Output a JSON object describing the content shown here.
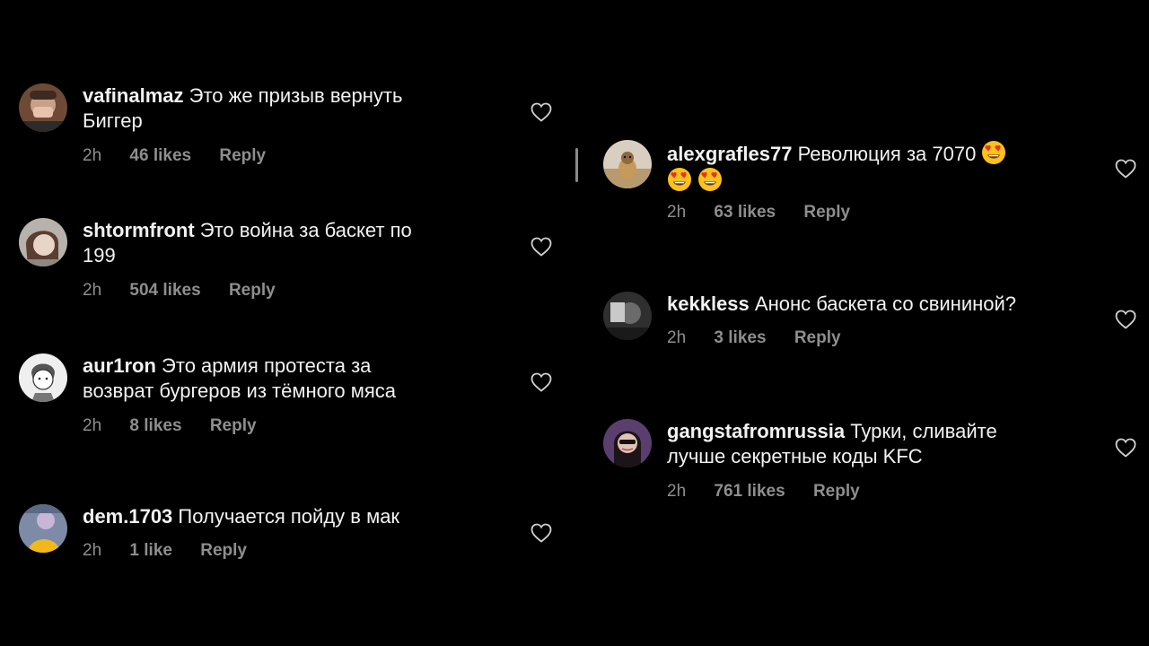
{
  "comments": [
    {
      "username": "vafinalmaz",
      "text": "Это же призыв вернуть",
      "text2": "Биггер",
      "time": "2h",
      "likes": "46 likes",
      "reply": "Reply"
    },
    {
      "username": "shtormfront",
      "text": "Это война за баскет по",
      "text2": "199",
      "time": "2h",
      "likes": "504 likes",
      "reply": "Reply"
    },
    {
      "username": "aur1ron",
      "text": "Это армия протеста за",
      "text2": "возврат бургеров из тёмного мяса",
      "time": "2h",
      "likes": "8 likes",
      "reply": "Reply"
    },
    {
      "username": "dem.1703",
      "text": "Получается пойду в мак",
      "time": "2h",
      "likes": "1 like",
      "reply": "Reply"
    },
    {
      "username": "alexgrafles77",
      "text": "Революция за 7070",
      "time": "2h",
      "likes": "63 likes",
      "reply": "Reply"
    },
    {
      "username": "kekkless",
      "text": "Анонс баскета со свининой?",
      "time": "2h",
      "likes": "3 likes",
      "reply": "Reply"
    },
    {
      "username": "gangstafromrussia",
      "text": "Турки, сливайте",
      "text2": "лучше секретные коды KFC",
      "time": "2h",
      "likes": "761 likes",
      "reply": "Reply"
    }
  ],
  "colors": {
    "background": "#000000",
    "meta": "#8e8e8e",
    "text": "#f2f2f2"
  },
  "icons": {
    "like": "heart-outline-icon",
    "emoji": "heart-eyes-emoji"
  }
}
